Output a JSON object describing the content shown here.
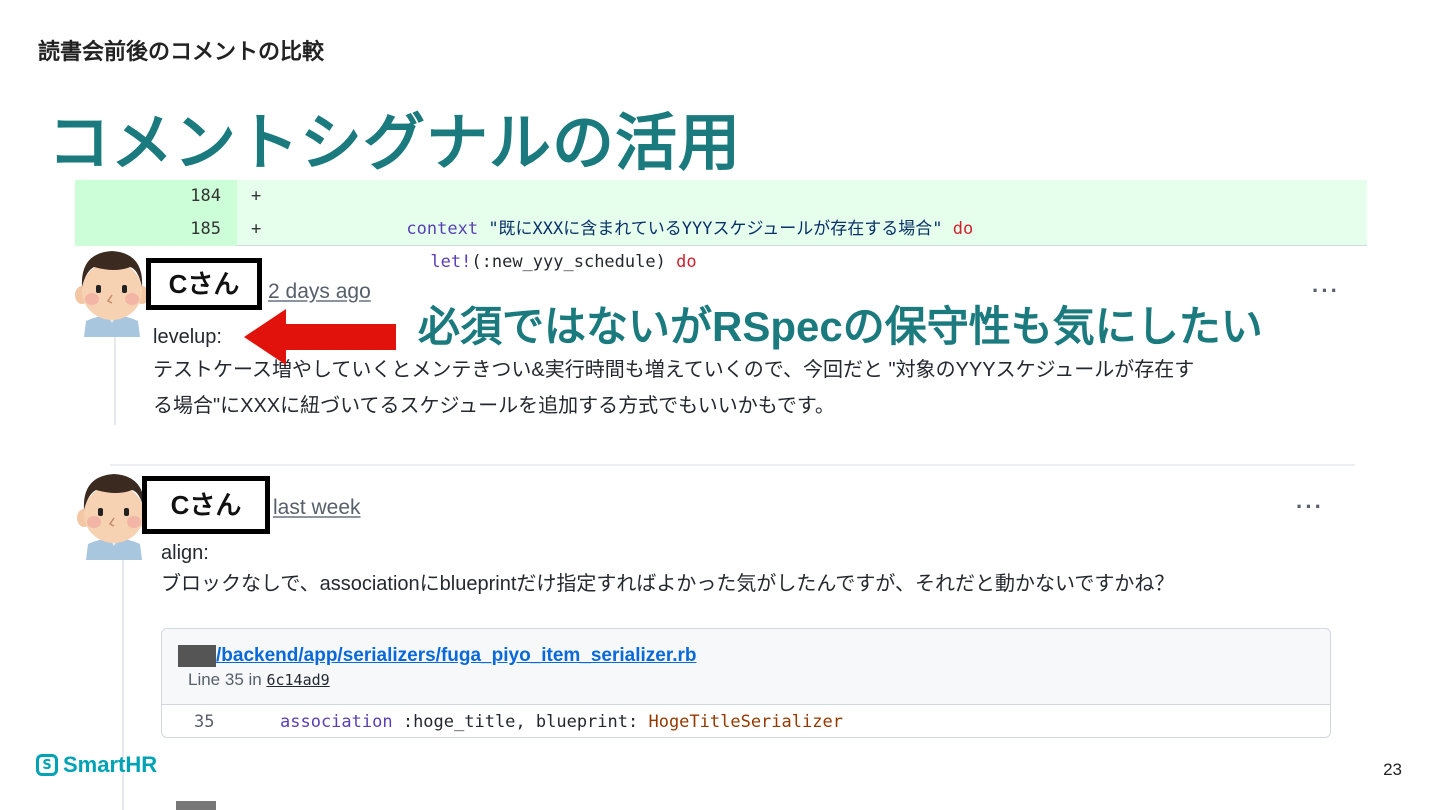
{
  "slide": {
    "subtitle": "読書会前後のコメントの比較",
    "title": "コメントシグナルの活用",
    "callout": "必須ではないがRSpecの保守性も気にしたい",
    "page_number": "23",
    "logo_text": "SmartHR",
    "logo_mark": "S"
  },
  "diff": {
    "rows": [
      {
        "line": "184",
        "sign": "+",
        "indent": "      ",
        "tokens": [
          {
            "t": "context ",
            "c": "kw-blue"
          },
          {
            "t": "\"既にXXXに含まれているYYYスケジュールが存在する場合\"",
            "c": "str"
          },
          {
            "t": " do",
            "c": "kw-red"
          }
        ]
      },
      {
        "line": "185",
        "sign": "+",
        "indent": "        ",
        "tokens": [
          {
            "t": "let!",
            "c": "kw-blue"
          },
          {
            "t": "(:new_yyy_schedule) ",
            "c": "plain"
          },
          {
            "t": "do",
            "c": "kw-red"
          }
        ]
      }
    ]
  },
  "comments": [
    {
      "author": "Cさん",
      "time": "2 days ago",
      "label": "levelup:",
      "body_lines": [
        "テストケース増やしていくとメンテきつい&実行時間も増えていくので、今回だと \"対象のYYYスケジュールが存在す",
        "る場合\"にXXXに紐づいてるスケジュールを追加する方式でもいいかもです。"
      ],
      "more": "···"
    },
    {
      "author": "Cさん",
      "time": "last week",
      "label": "align:",
      "body_lines": [
        "ブロックなしで、associationにblueprintだけ指定すればよかった気がしたんですが、それだと動かないですかね？"
      ],
      "more": "···"
    }
  ],
  "file_ref": {
    "path": "/backend/app/serializers/fuga_piyo_item_serializer.rb",
    "line_prefix": "Line 35 in ",
    "sha": "6c14ad9",
    "code_line": "35",
    "code_tokens": [
      {
        "t": "association ",
        "c": "kw-blue"
      },
      {
        "t": ":hoge_title, blueprint: ",
        "c": "plain"
      },
      {
        "t": "HogeTitleSerializer",
        "c": "const"
      }
    ]
  },
  "colors": {
    "title": "#1a7a7e",
    "diff_added_bg": "#e6ffec",
    "diff_gutter_bg": "#ccffd8",
    "arrow": "#e0120b",
    "link": "#0969da",
    "logo": "#00a3b5"
  },
  "icons": {
    "avatar": "cartoon-man-avatar-icon",
    "arrow": "left-arrow-icon",
    "more": "ellipsis-icon",
    "logo": "smarthr-logo-icon"
  }
}
